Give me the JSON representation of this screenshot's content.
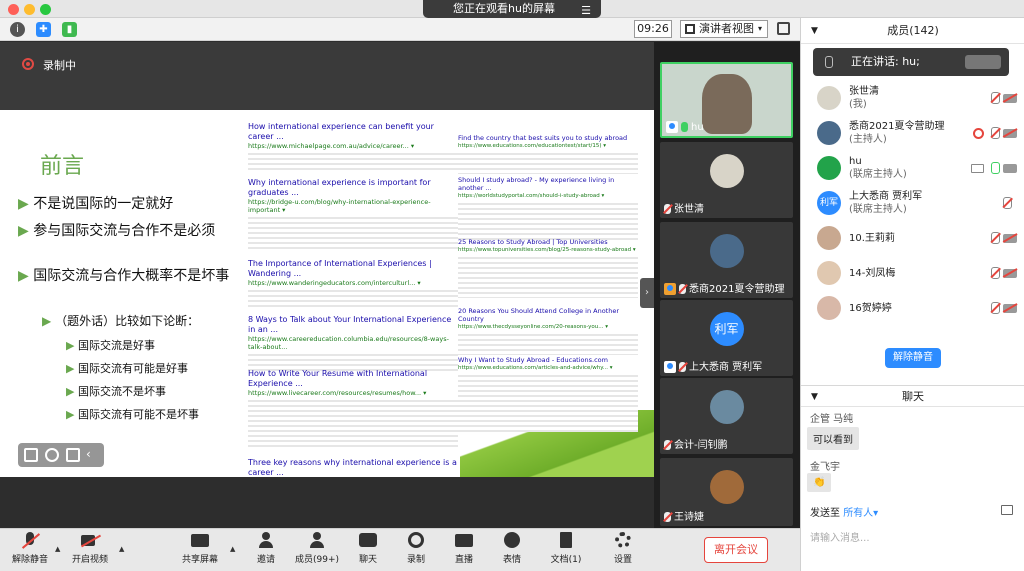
{
  "window": {
    "title": "您正在观看hu的屏幕"
  },
  "topbar": {
    "time": "09:26",
    "view_mode": "演讲者视图"
  },
  "recording": {
    "label": "录制中"
  },
  "slide": {
    "title": "前言",
    "bullets": [
      {
        "text": "不是说国际的一定就好",
        "level": 1
      },
      {
        "text": "参与国际交流与合作不是必须",
        "level": 1
      },
      {
        "text": "国际交流与合作大概率不是坏事",
        "level": 1
      },
      {
        "text": "（题外话）比较如下论断：",
        "level": 2
      },
      {
        "text": "国际交流是好事",
        "level": 3
      },
      {
        "text": "国际交流有可能是好事",
        "level": 3
      },
      {
        "text": "国际交流不是坏事",
        "level": 3
      },
      {
        "text": "国际交流有可能不是坏事",
        "level": 3
      }
    ],
    "search_results_left": [
      {
        "title": "How international experience can benefit your career ...",
        "url": "https://www.michaelpage.com.au/advice/career... ▾"
      },
      {
        "title": "Why international experience is important for graduates ...",
        "url": "https://bridge-u.com/blog/why-international-experience-important ▾"
      },
      {
        "title": "The Importance of International Experiences | Wandering ...",
        "url": "https://www.wanderingeducators.com/interculturl... ▾"
      },
      {
        "title": "8 Ways to Talk about Your International Experience in an ...",
        "url": "https://www.careereducation.columbia.edu/resources/8-ways-talk-about..."
      },
      {
        "title": "How to Write Your Resume with International Experience ...",
        "url": "https://www.livecareer.com/resources/resumes/how... ▾"
      },
      {
        "title": "Three key reasons why international experience is a career ...",
        "url": ""
      }
    ],
    "search_results_right": [
      {
        "title": "Find the country that best suits you to study abroad",
        "url": "https://www.educations.com/educationtest/start/15) ▾"
      },
      {
        "title": "Should I study abroad? - My experience living in another ...",
        "url": "https://worldstudyportal.com/should-i-study-abroad ▾"
      },
      {
        "title": "25 Reasons to Study Abroad | Top Universities",
        "url": "https://www.topuniversities.com/blog/25-reasons-study-abroad ▾"
      },
      {
        "title": "20 Reasons You Should Attend College in Another Country",
        "url": "https://www.thecdysseyonline.com/20-reasons-you... ▾"
      },
      {
        "title": "Why I Want to Study Abroad - Educations.com",
        "url": "https://www.educations.com/articles-and-advice/why... ▾"
      }
    ]
  },
  "gallery": [
    {
      "name": "hu",
      "active": true,
      "muted": false,
      "host": true
    },
    {
      "name": "张世清",
      "active": false,
      "muted": true,
      "host": false
    },
    {
      "name": "悉商2021夏令营助理",
      "active": false,
      "muted": true,
      "host": true
    },
    {
      "name": "上大悉商 贾利军",
      "active": false,
      "muted": true,
      "host": true,
      "avatar_text": "利军"
    },
    {
      "name": "会计-闫钊鹏",
      "active": false,
      "muted": true,
      "host": false
    },
    {
      "name": "王诗婕",
      "active": false,
      "muted": true,
      "host": false
    }
  ],
  "toolbar": {
    "unmute": "解除静音",
    "start_video": "开启视频",
    "share_screen": "共享屏幕",
    "invite": "邀请",
    "participants": "成员(99+)",
    "chat": "聊天",
    "record": "录制",
    "live": "直播",
    "reactions": "表情",
    "documents": "文档(1)",
    "settings": "设置",
    "leave": "离开会议"
  },
  "participants_panel": {
    "title": "成员(142)",
    "speaking": "正在讲话: hu;",
    "list": [
      {
        "name": "张世清",
        "role": "(我)"
      },
      {
        "name": "悉商2021夏令营助理",
        "role": "(主持人)"
      },
      {
        "name": "hu",
        "role": "(联席主持人)"
      },
      {
        "name": "上大悉商 贾利军",
        "role": "(联席主持人)",
        "avatar_text": "利军"
      },
      {
        "name": "10.王莉莉",
        "role": ""
      },
      {
        "name": "14-刘凤梅",
        "role": ""
      },
      {
        "name": "16贺婷婷",
        "role": ""
      }
    ],
    "unmute_button": "解除静音"
  },
  "chat": {
    "title": "聊天",
    "messages": [
      {
        "sender": "企管 马纯",
        "text": "可以看到"
      },
      {
        "sender": "金飞宇",
        "text": "👏"
      }
    ],
    "send_to_label": "发送至",
    "send_to_target": "所有人▾",
    "placeholder": "请输入消息..."
  },
  "colors": {
    "accent": "#2d8cff",
    "danger": "#e5453d",
    "active_speaker": "#3fd062",
    "slide_green": "#6aa84f"
  }
}
